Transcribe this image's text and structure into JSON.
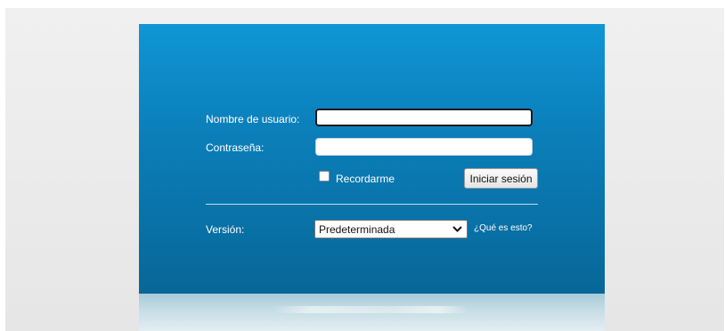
{
  "login": {
    "username_label": "Nombre de usuario:",
    "username_value": "",
    "password_label": "Contraseña:",
    "password_value": "",
    "remember_label": "Recordarme",
    "remember_checked": false,
    "submit_label": "Iniciar sesión",
    "version_label": "Versión:",
    "version_selected": "Predeterminada",
    "help_link": "¿Qué es esto?"
  },
  "colors": {
    "panel_top": "#0f96d5",
    "panel_bottom": "#076797",
    "label_text": "#ffffff"
  },
  "icons": {
    "select_arrow": "chevron-down-icon"
  }
}
